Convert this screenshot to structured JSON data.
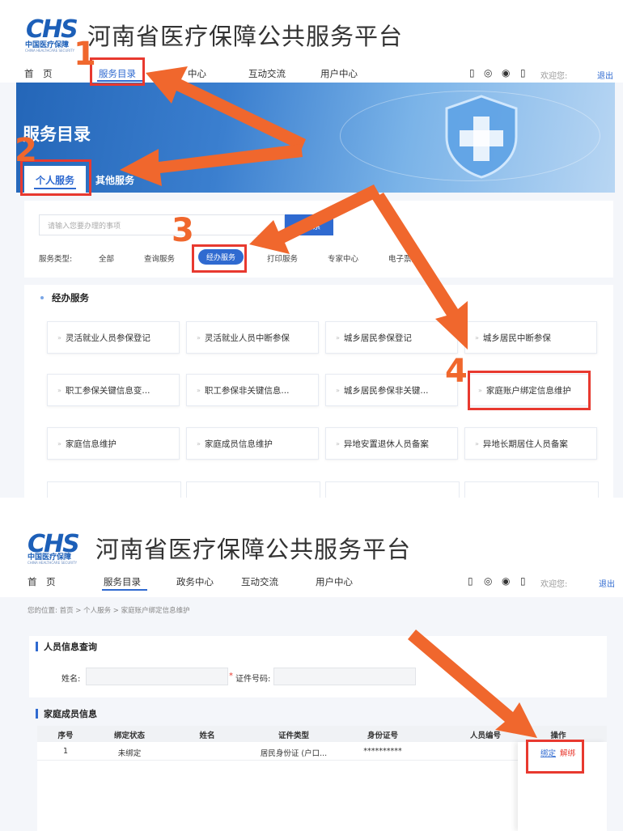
{
  "top": {
    "logo": {
      "mark": "CHS",
      "name": "中国医疗保障",
      "tagline": "CHINA HEALTHCARE SECURITY"
    },
    "title": "河南省医疗保障公共服务平台",
    "nav": [
      {
        "label": "首　页"
      },
      {
        "label": "服务目录"
      },
      {
        "label": "中心"
      },
      {
        "label": "互动交流"
      },
      {
        "label": "用户中心"
      }
    ],
    "welcome": "欢迎您:",
    "logout": "退出",
    "banner_title": "服务目录",
    "tabs": [
      {
        "label": "个人服务"
      },
      {
        "label": "其他服务"
      }
    ],
    "search": {
      "placeholder": "请输入您要办理的事项",
      "button": "搜索"
    },
    "filter_label": "服务类型:",
    "filters": [
      "全部",
      "查询服务",
      "经办服务",
      "打印服务",
      "专家中心",
      "电子票据"
    ],
    "section_title": "经办服务",
    "cards": [
      [
        "灵活就业人员参保登记",
        "灵活就业人员中断参保",
        "城乡居民参保登记",
        "城乡居民中断参保"
      ],
      [
        "职工参保关键信息变...",
        "职工参保非关键信息...",
        "城乡居民参保非关键...",
        "家庭账户绑定信息维护"
      ],
      [
        "家庭信息维护",
        "家庭成员信息维护",
        "异地安置退休人员备案",
        "异地长期居住人员备案"
      ]
    ],
    "steps": [
      "1",
      "2",
      "3",
      "4"
    ]
  },
  "bottom": {
    "logo": {
      "mark": "CHS",
      "name": "中国医疗保障",
      "tagline": "CHINA HEALTHCARE SECURITY"
    },
    "title": "河南省医疗保障公共服务平台",
    "nav": [
      {
        "label": "首　页"
      },
      {
        "label": "服务目录"
      },
      {
        "label": "政务中心"
      },
      {
        "label": "互动交流"
      },
      {
        "label": "用户中心"
      }
    ],
    "welcome": "欢迎您:",
    "logout": "退出",
    "breadcrumb": "您的位置: 首页 > 个人服务 > 家庭账户绑定信息维护",
    "query_title": "人员信息查询",
    "name_label": "姓名:",
    "id_label": "证件号码:",
    "family_title": "家庭成员信息",
    "table": {
      "headers": [
        "序号",
        "绑定状态",
        "姓名",
        "证件类型",
        "身份证号",
        "人员编号",
        "操作"
      ],
      "rows": [
        {
          "no": "1",
          "status": "未绑定",
          "name": "",
          "id_type": "居民身份证 (户口...",
          "id_no": "**********",
          "person_no": "",
          "bind": "绑定",
          "unbind": "解绑"
        }
      ]
    }
  },
  "colors": {
    "accent": "#2f6ad0",
    "annotation": "#f0672d",
    "highlight": "#e8392f"
  }
}
